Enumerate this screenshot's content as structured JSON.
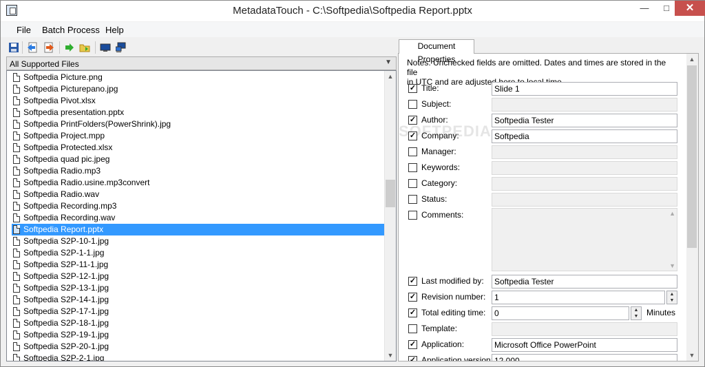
{
  "window": {
    "title": "MetadataTouch - C:\\Softpedia\\Softpedia Report.pptx",
    "minimize_glyph": "—",
    "maximize_glyph": "□",
    "close_glyph": "✕"
  },
  "menu": [
    "File",
    "Batch Process",
    "Help"
  ],
  "toolbar": {
    "icons": [
      "save-icon",
      "back-icon",
      "forward-icon",
      "apply-icon",
      "open-folder-icon",
      "monitor-icon",
      "network-icon"
    ]
  },
  "filter": {
    "selected": "All Supported Files"
  },
  "files": [
    "Softpedia Picture.png",
    "Softpedia Picturepano.jpg",
    "Softpedia Pivot.xlsx",
    "Softpedia presentation.pptx",
    "Softpedia PrintFolders(PowerShrink).jpg",
    "Softpedia Project.mpp",
    "Softpedia Protected.xlsx",
    "Softpedia quad pic.jpeg",
    "Softpedia Radio.mp3",
    "Softpedia Radio.usine.mp3convert",
    "Softpedia Radio.wav",
    "Softpedia Recording.mp3",
    "Softpedia Recording.wav",
    "Softpedia Report.pptx",
    "Softpedia S2P-10-1.jpg",
    "Softpedia S2P-1-1.jpg",
    "Softpedia S2P-11-1.jpg",
    "Softpedia S2P-12-1.jpg",
    "Softpedia S2P-13-1.jpg",
    "Softpedia S2P-14-1.jpg",
    "Softpedia S2P-17-1.jpg",
    "Softpedia S2P-18-1.jpg",
    "Softpedia S2P-19-1.jpg",
    "Softpedia S2P-20-1.jpg",
    "Softpedia S2P-2-1.jpg"
  ],
  "selected_file": "Softpedia Report.pptx",
  "tab": {
    "label": "Document Properties"
  },
  "notes": [
    "Notes: Unchecked fields are omitted. Dates and times are stored in the file",
    "in UTC and are adjusted here to local time."
  ],
  "properties": [
    {
      "label": "Title:",
      "checked": true,
      "value": "Slide 1"
    },
    {
      "label": "Subject:",
      "checked": false,
      "value": ""
    },
    {
      "label": "Author:",
      "checked": true,
      "value": "Softpedia Tester"
    },
    {
      "label": "Company:",
      "checked": true,
      "value": "Softpedia"
    },
    {
      "label": "Manager:",
      "checked": false,
      "value": ""
    },
    {
      "label": "Keywords:",
      "checked": false,
      "value": ""
    },
    {
      "label": "Category:",
      "checked": false,
      "value": ""
    },
    {
      "label": "Status:",
      "checked": false,
      "value": ""
    },
    {
      "label": "Comments:",
      "checked": false,
      "value": ""
    },
    {
      "label": "Last modified by:",
      "checked": true,
      "value": "Softpedia Tester"
    },
    {
      "label": "Revision number:",
      "checked": true,
      "value": "1"
    },
    {
      "label": "Total editing time:",
      "checked": true,
      "value": "0",
      "unit": "Minutes"
    },
    {
      "label": "Template:",
      "checked": false,
      "value": ""
    },
    {
      "label": "Application:",
      "checked": true,
      "value": "Microsoft Office PowerPoint"
    },
    {
      "label": "Application version:",
      "checked": true,
      "value": "12.000"
    }
  ],
  "watermark": "SOFTPEDIA"
}
